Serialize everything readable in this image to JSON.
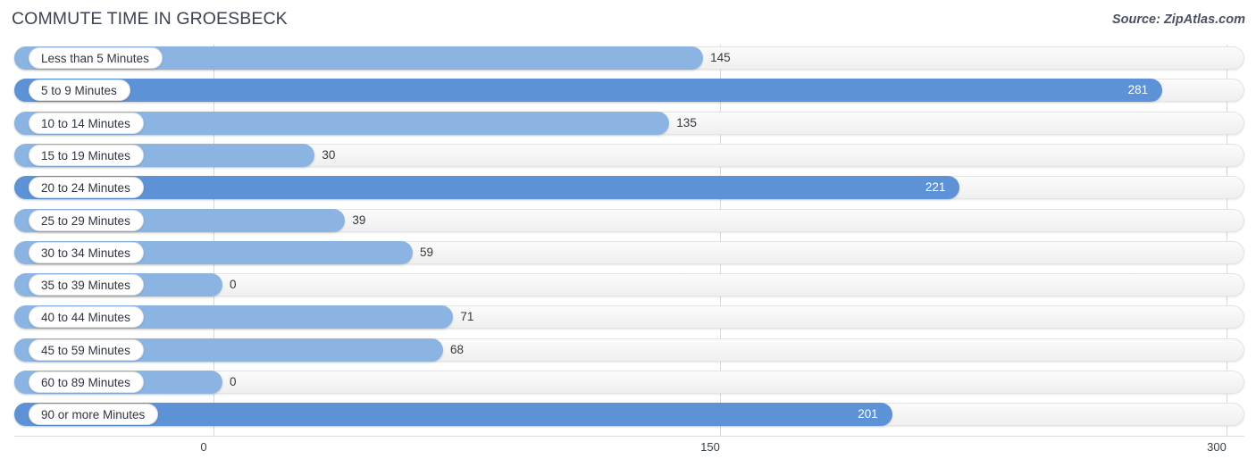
{
  "header": {
    "title": "COMMUTE TIME IN GROESBECK",
    "source": "Source: ZipAtlas.com"
  },
  "chart_data": {
    "type": "bar",
    "orientation": "horizontal",
    "title": "COMMUTE TIME IN GROESBECK",
    "subtitle": "Source: ZipAtlas.com",
    "xlabel": "",
    "ylabel": "",
    "xlim": [
      0,
      300
    ],
    "ticks": [
      "0",
      "150",
      "300"
    ],
    "tick_values": [
      0,
      150,
      300
    ],
    "grid": true,
    "legend": "none",
    "categories": [
      "Less than 5 Minutes",
      "5 to 9 Minutes",
      "10 to 14 Minutes",
      "15 to 19 Minutes",
      "20 to 24 Minutes",
      "25 to 29 Minutes",
      "30 to 34 Minutes",
      "35 to 39 Minutes",
      "40 to 44 Minutes",
      "45 to 59 Minutes",
      "60 to 89 Minutes",
      "90 or more Minutes"
    ],
    "values": [
      145,
      281,
      135,
      30,
      221,
      39,
      59,
      0,
      71,
      68,
      0,
      201
    ],
    "value_labels": [
      "145",
      "281",
      "135",
      "30",
      "221",
      "39",
      "59",
      "0",
      "71",
      "68",
      "0",
      "201"
    ],
    "colors": {
      "bar_light": "#8cb4e2",
      "bar_dark": "#5d92d7",
      "track": "#f6f6f6",
      "gridline": "#d9d9d9",
      "text": "#33383f",
      "title": "#3c4451"
    },
    "series": [
      {
        "name": "Commute Time",
        "values": [
          145,
          281,
          135,
          30,
          221,
          39,
          59,
          0,
          71,
          68,
          0,
          201
        ]
      }
    ]
  },
  "rows": [
    {
      "label": "Less than 5 Minutes",
      "value": 145,
      "text": "145",
      "shade": "light",
      "inside": false
    },
    {
      "label": "5 to 9 Minutes",
      "value": 281,
      "text": "281",
      "shade": "dark",
      "inside": true
    },
    {
      "label": "10 to 14 Minutes",
      "value": 135,
      "text": "135",
      "shade": "light",
      "inside": false
    },
    {
      "label": "15 to 19 Minutes",
      "value": 30,
      "text": "30",
      "shade": "light",
      "inside": false
    },
    {
      "label": "20 to 24 Minutes",
      "value": 221,
      "text": "221",
      "shade": "dark",
      "inside": true
    },
    {
      "label": "25 to 29 Minutes",
      "value": 39,
      "text": "39",
      "shade": "light",
      "inside": false
    },
    {
      "label": "30 to 34 Minutes",
      "value": 59,
      "text": "59",
      "shade": "light",
      "inside": false
    },
    {
      "label": "35 to 39 Minutes",
      "value": 0,
      "text": "0",
      "shade": "light",
      "inside": false
    },
    {
      "label": "40 to 44 Minutes",
      "value": 71,
      "text": "71",
      "shade": "light",
      "inside": false
    },
    {
      "label": "45 to 59 Minutes",
      "value": 68,
      "text": "68",
      "shade": "light",
      "inside": false
    },
    {
      "label": "60 to 89 Minutes",
      "value": 0,
      "text": "0",
      "shade": "light",
      "inside": false
    },
    {
      "label": "90 or more Minutes",
      "value": 201,
      "text": "201",
      "shade": "dark",
      "inside": true
    }
  ],
  "axis": {
    "ticks": [
      {
        "label": "0",
        "value": 0
      },
      {
        "label": "150",
        "value": 150
      },
      {
        "label": "300",
        "value": 300
      }
    ]
  }
}
